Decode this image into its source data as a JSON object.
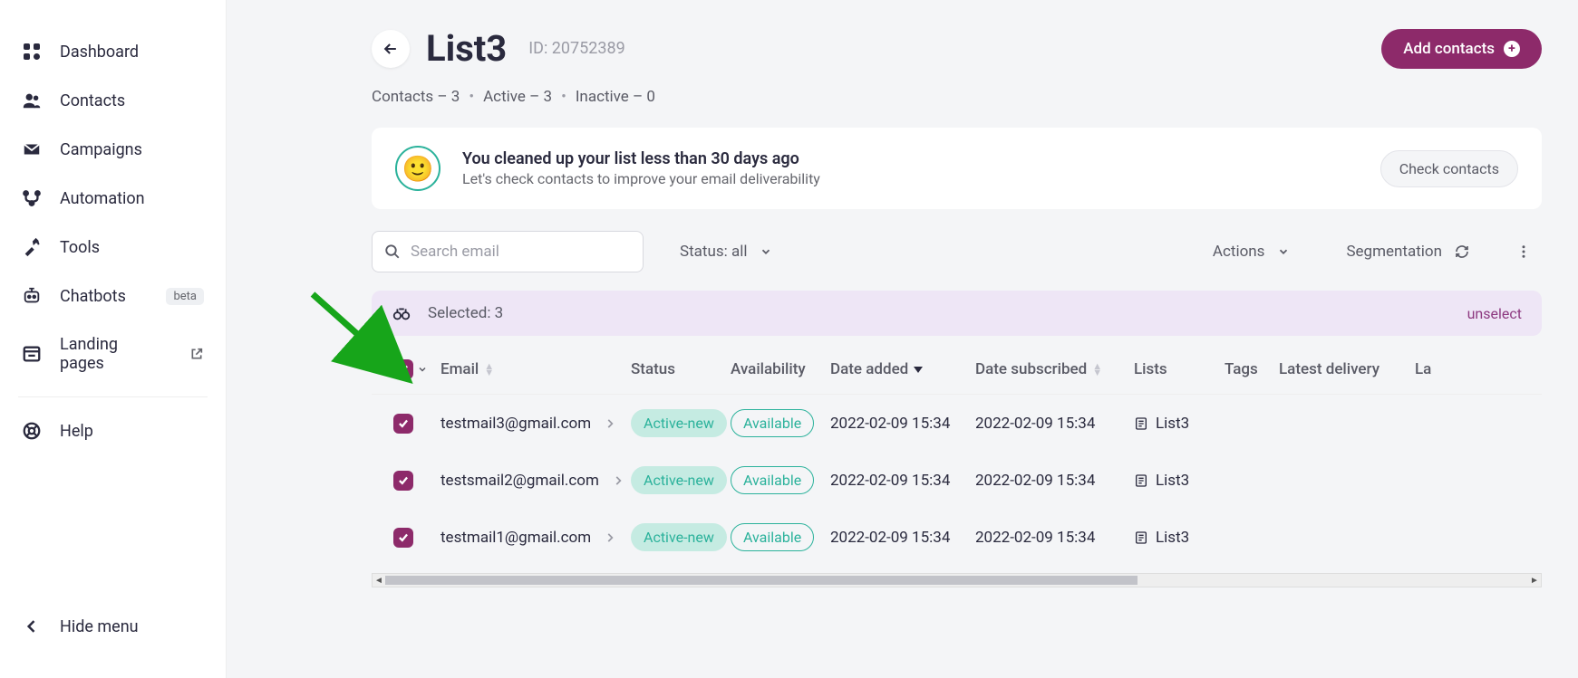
{
  "sidebar": {
    "items": [
      {
        "label": "Dashboard"
      },
      {
        "label": "Contacts"
      },
      {
        "label": "Campaigns"
      },
      {
        "label": "Automation"
      },
      {
        "label": "Tools"
      },
      {
        "label": "Chatbots",
        "badge": "beta"
      },
      {
        "label": "Landing pages"
      }
    ],
    "help": "Help",
    "hide": "Hide menu"
  },
  "header": {
    "title": "List3",
    "id_label": "ID: 20752389",
    "add_contacts": "Add contacts"
  },
  "stats": {
    "contacts": "Contacts – 3",
    "active": "Active – 3",
    "inactive": "Inactive – 0"
  },
  "banner": {
    "title": "You cleaned up your list less than 30 days ago",
    "sub": "Let's check contacts to improve your email deliverability",
    "cta": "Check contacts"
  },
  "toolbar": {
    "search_placeholder": "Search email",
    "status_filter": "Status: all",
    "actions": "Actions",
    "segmentation": "Segmentation"
  },
  "selection": {
    "label": "Selected: 3",
    "unselect": "unselect"
  },
  "columns": {
    "email": "Email",
    "status": "Status",
    "availability": "Availability",
    "date_added": "Date added",
    "date_subscribed": "Date subscribed",
    "lists": "Lists",
    "tags": "Tags",
    "latest_delivery": "Latest delivery",
    "la": "La"
  },
  "rows": [
    {
      "email": "testmail3@gmail.com",
      "status": "Active-new",
      "availability": "Available",
      "date_added": "2022-02-09 15:34",
      "date_subscribed": "2022-02-09 15:34",
      "lists": "List3"
    },
    {
      "email": "testsmail2@gmail.com",
      "status": "Active-new",
      "availability": "Available",
      "date_added": "2022-02-09 15:34",
      "date_subscribed": "2022-02-09 15:34",
      "lists": "List3"
    },
    {
      "email": "testmail1@gmail.com",
      "status": "Active-new",
      "availability": "Available",
      "date_added": "2022-02-09 15:34",
      "date_subscribed": "2022-02-09 15:34",
      "lists": "List3"
    }
  ]
}
